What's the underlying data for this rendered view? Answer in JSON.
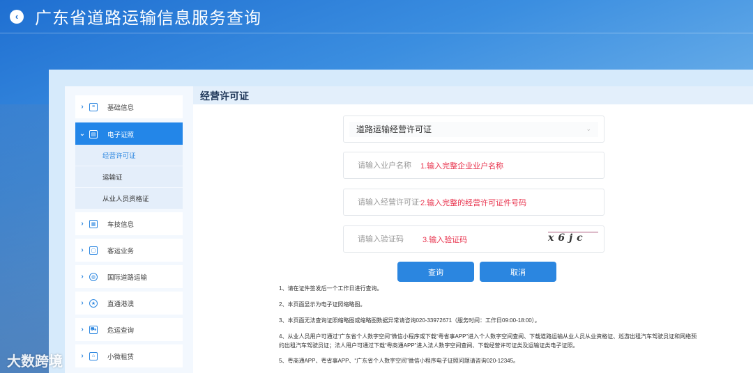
{
  "header": {
    "title": "广东省道路运输信息服务查询"
  },
  "content": {
    "title": "经营许可证"
  },
  "sidebar": {
    "items": [
      {
        "label": "基础信息",
        "icon": "document-icon"
      },
      {
        "label": "电子证照",
        "icon": "id-card-icon",
        "expanded": true,
        "children": [
          "经营许可证",
          "运输证",
          "从业人员资格证"
        ]
      },
      {
        "label": "车技信息",
        "icon": "vehicle-tech-icon"
      },
      {
        "label": "客运业务",
        "icon": "bus-icon"
      },
      {
        "label": "国际道路运输",
        "icon": "globe-icon"
      },
      {
        "label": "直通港澳",
        "icon": "star-circle-icon"
      },
      {
        "label": "危运查询",
        "icon": "truck-icon"
      },
      {
        "label": "小微租赁",
        "icon": "rental-icon"
      }
    ]
  },
  "form": {
    "select_value": "道路运输经营许可证",
    "name_placeholder": "请输入业户名称",
    "name_hint": "1.输入完整企业业户名称",
    "license_placeholder": "请输入经营许可证号",
    "license_hint": "2.输入完整的经营许可证件号码",
    "captcha_placeholder": "请输入验证码",
    "captcha_hint": "3.输入验证码",
    "captcha_text": "x6jc",
    "query_label": "查询",
    "cancel_label": "取消"
  },
  "notes": [
    "1、请在证件签发后一个工作日进行查询。",
    "2、本页面显示为电子证照缩略图。",
    "3、本页面无法查询证照缩略图或缩略图数据异常请咨询020-33972671（服务时间：工作日09:00-18:00）。",
    "4、从业人员用户可通过“广东省个人数字空间”微信小程序或下载“粤省事APP”进入个人数字空间查阅、下载道路运输从业人员从业资格证、巡游出租汽车驾驶员证和网络预约出租汽车驾驶员证；法人用户可通过下载“粤商通APP”进入法人数字空间查阅、下载经营许可证类及运输证类电子证照。",
    "5、粤商通APP、粤省事APP、“广东省个人数字空间”微信小程序电子证照问题请咨询020-12345。"
  ],
  "watermark": "大数跨境"
}
